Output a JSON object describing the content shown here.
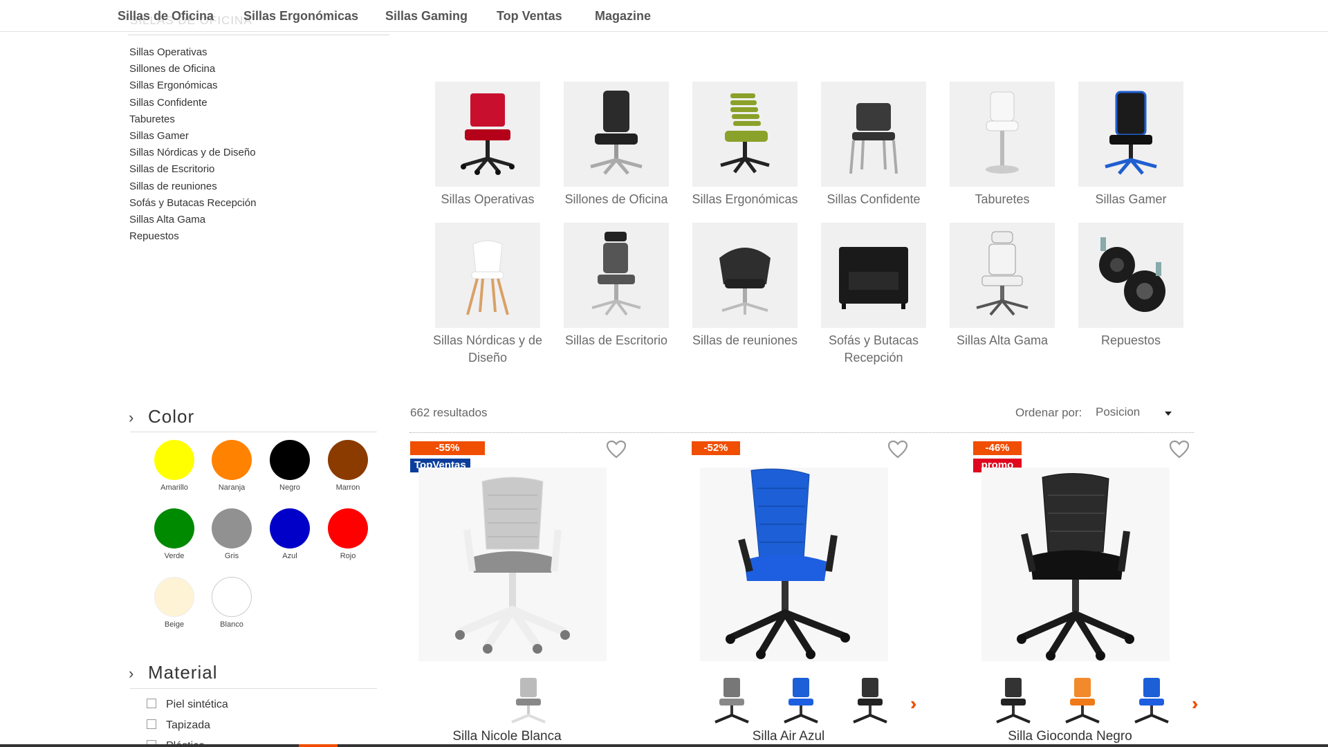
{
  "nav": {
    "items": [
      "Sillas de Oficina",
      "Sillas Ergonómicas",
      "Sillas Gaming",
      "Top Ventas",
      "Magazine"
    ],
    "ghost_heading": "SILLAS DE OFICINA"
  },
  "sidebar": {
    "categories": [
      "Sillas Operativas",
      "Sillones de Oficina",
      "Sillas Ergonómicas",
      "Sillas Confidente",
      "Taburetes",
      "Sillas Gamer",
      "Sillas Nórdicas y de Diseño",
      "Sillas de Escritorio",
      "Sillas de reuniones",
      "Sofás y Butacas Recepción",
      "Sillas Alta Gama",
      "Repuestos"
    ]
  },
  "tiles": [
    "Sillas Operativas",
    "Sillones de Oficina",
    "Sillas Ergonómicas",
    "Sillas Confidente",
    "Taburetes",
    "Sillas Gamer",
    "Sillas Nórdicas y de Diseño",
    "Sillas de Escritorio",
    "Sillas de reuniones",
    "Sofás y Butacas Recepción",
    "Sillas Alta Gama",
    "Repuestos"
  ],
  "filters": {
    "color": {
      "title": "Color",
      "swatches": [
        {
          "name": "Amarillo",
          "color": "#ffff00"
        },
        {
          "name": "Naranja",
          "color": "#ff8200"
        },
        {
          "name": "Negro",
          "color": "#000000"
        },
        {
          "name": "Marron",
          "color": "#8b3a00"
        },
        {
          "name": "Verde",
          "color": "#008a00"
        },
        {
          "name": "Gris",
          "color": "#919191"
        },
        {
          "name": "Azul",
          "color": "#0000c8"
        },
        {
          "name": "Rojo",
          "color": "#ff0000"
        },
        {
          "name": "Beige",
          "color": "#fff3d6"
        },
        {
          "name": "Blanco",
          "color": "#ffffff"
        }
      ]
    },
    "material": {
      "title": "Material",
      "options": [
        "Piel sintética",
        "Tapizada",
        "Plástico"
      ]
    }
  },
  "results": {
    "count": "662 resultados",
    "sort_label": "Ordenar por:",
    "sort_value": "Posicion"
  },
  "products": [
    {
      "name": "Silla Nicole Blanca",
      "discount": "-55%",
      "tag": "TopVentas",
      "tag_color": "#0b3e9c",
      "main_color": "gray",
      "thumbs": [
        "gray"
      ],
      "has_arrow": false
    },
    {
      "name": "Silla Air Azul",
      "discount": "-52%",
      "tag": "",
      "tag_color": "",
      "main_color": "blue",
      "thumbs": [
        "gray",
        "blue",
        "black"
      ],
      "has_arrow": true
    },
    {
      "name": "Silla Gioconda Negro",
      "discount": "-46%",
      "tag": "promo",
      "tag_color": "#e0061f",
      "main_color": "black",
      "thumbs": [
        "black",
        "orange",
        "blue"
      ],
      "has_arrow": true
    }
  ],
  "colors": {
    "accent": "#f04e00"
  }
}
